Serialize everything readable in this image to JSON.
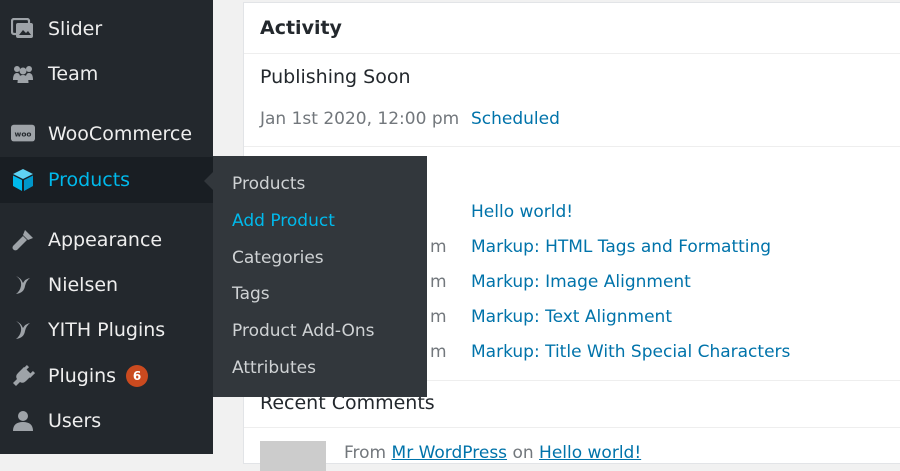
{
  "sidebar": {
    "items": [
      {
        "label": "Slider",
        "icon": "slider-icon"
      },
      {
        "label": "Team",
        "icon": "team-icon"
      },
      {
        "label": "WooCommerce",
        "icon": "woocommerce-icon"
      },
      {
        "label": "Products",
        "icon": "products-icon",
        "current": true
      },
      {
        "label": "Appearance",
        "icon": "appearance-icon"
      },
      {
        "label": "Nielsen",
        "icon": "yith-icon"
      },
      {
        "label": "YITH Plugins",
        "icon": "yith-icon"
      },
      {
        "label": "Plugins",
        "icon": "plugins-icon",
        "badge": "6"
      },
      {
        "label": "Users",
        "icon": "users-icon"
      }
    ],
    "woo_icon_text": "woo"
  },
  "submenu": {
    "items": [
      "Products",
      "Add Product",
      "Categories",
      "Tags",
      "Product Add-Ons",
      "Attributes"
    ],
    "active": "Add Product"
  },
  "activity": {
    "title": "Activity",
    "publishing_soon": {
      "title": "Publishing Soon",
      "rows": [
        {
          "date": "Jan 1st 2020, 12:00 pm",
          "link": "Scheduled"
        }
      ]
    },
    "recently_published": {
      "rows": [
        {
          "date_visible": "",
          "link": "Hello world!"
        },
        {
          "date_visible": "m",
          "link": "Markup: HTML Tags and Formatting"
        },
        {
          "date_visible": "m",
          "link": "Markup: Image Alignment"
        },
        {
          "date_visible": "m",
          "link": "Markup: Text Alignment"
        },
        {
          "date_visible": "m",
          "link": "Markup: Title With Special Characters"
        }
      ]
    },
    "recent_comments": {
      "title": "Recent Comments",
      "comment": {
        "from": "From",
        "author": "Mr WordPress",
        "on": "on",
        "post": "Hello world!"
      }
    }
  },
  "colors": {
    "sidebar_bg": "#23282d",
    "flyout_bg": "#32373c",
    "accent": "#00b9eb",
    "link": "#0073aa",
    "badge": "#ca4a1f"
  }
}
